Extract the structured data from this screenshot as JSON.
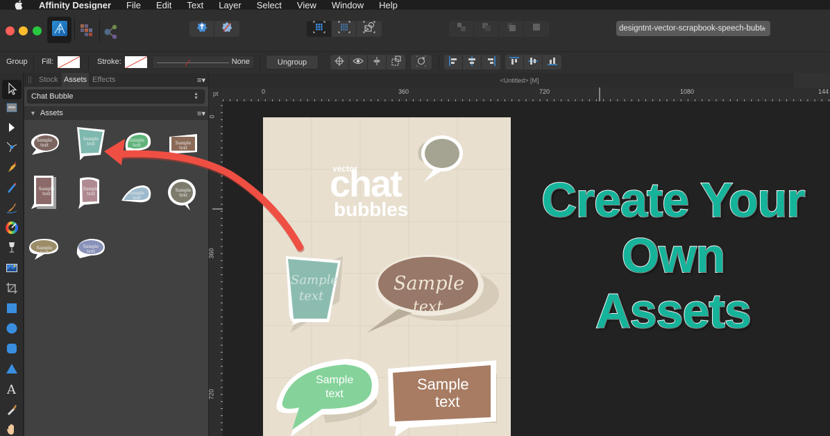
{
  "menubar": {
    "apple_icon": "apple-logo",
    "app_name": "Affinity Designer",
    "items": [
      "File",
      "Edit",
      "Text",
      "Layer",
      "Select",
      "View",
      "Window",
      "Help"
    ]
  },
  "toolbar": {
    "personas": [
      "designer-persona-icon",
      "pixel-persona-icon",
      "export-persona-icon"
    ],
    "isolation_buttons": [
      "place-image-icon",
      "no-preview-icon"
    ],
    "view_modes": [
      "pixel-grid-icon",
      "retina-grid-icon",
      "vector-outline-icon"
    ],
    "arrange_buttons": [
      "move-back-icon",
      "move-backward-icon",
      "move-forward-icon",
      "move-front-icon"
    ],
    "document_tab": "designtnt-vector-scrapbook-speech-bubt",
    "document_tab_star": "★"
  },
  "context": {
    "selection_type": "Group",
    "fill_label": "Fill:",
    "stroke_label": "Stroke:",
    "stroke_width_value": "None",
    "ungroup_label": "Ungroup",
    "transform_icons": [
      "origin-icon",
      "visibility-icon",
      "flip-icon",
      "constraint-icon"
    ],
    "rotate_icon": "rotate-icon",
    "align_h_icons": [
      "align-left-icon",
      "align-center-icon",
      "align-right-icon"
    ],
    "align_v_icons": [
      "align-top-icon",
      "align-middle-icon",
      "align-bottom-icon"
    ]
  },
  "tools": [
    "move-tool",
    "artboard-tool",
    "node-tool",
    "corner-tool",
    "pen-tool",
    "pencil-tool",
    "vector-brush-tool",
    "fill-tool",
    "transparency-tool",
    "place-image-tool",
    "crop-tool",
    "rectangle-tool",
    "ellipse-tool",
    "rounded-rectangle-tool",
    "triangle-tool",
    "text-tool",
    "color-picker-tool",
    "hand-tool"
  ],
  "panel": {
    "tabs": [
      {
        "label": "Stock",
        "active": false
      },
      {
        "label": "Assets",
        "active": true
      },
      {
        "label": "Effects",
        "active": false
      }
    ],
    "category": "Chat Bubble",
    "section_title": "Assets",
    "assets": [
      {
        "name": "brown-oval-bubble",
        "color": "#7d655f",
        "label": "Sample text"
      },
      {
        "name": "teal-square-bubble",
        "color": "#7fb8ae",
        "label": "Sample text"
      },
      {
        "name": "green-blob-bubble",
        "color": "#5fb47a",
        "label": "Sample text"
      },
      {
        "name": "brown-rect-bubble",
        "color": "#8b6a58",
        "label": "Sample text"
      },
      {
        "name": "mauve-tall-bubble",
        "color": "#8c6a69",
        "label": "Sample text"
      },
      {
        "name": "pink-wavy-bubble",
        "color": "#b08a91",
        "label": "Sample text"
      },
      {
        "name": "blue-drop-bubble",
        "color": "#9cbacb",
        "label": "Sample text"
      },
      {
        "name": "olive-round-bubble",
        "color": "#7d7b6c",
        "label": "Sample text"
      },
      {
        "name": "khaki-wide-bubble",
        "color": "#9c8c68",
        "label": "Sample text"
      },
      {
        "name": "periwinkle-bubble",
        "color": "#8891b8",
        "label": "Sample text"
      }
    ]
  },
  "document": {
    "title": "<Untitled> [M]",
    "ruler_unit": "pt",
    "ruler_h_labels": [
      "0",
      "360",
      "720",
      "1080",
      "144"
    ],
    "ruler_v_labels": [
      "0",
      "360",
      "720"
    ]
  },
  "artboard": {
    "title_small": "vector",
    "title_big": "chat",
    "title_sub": "bubbles",
    "bubbles": [
      {
        "name": "teal-bubble",
        "line1": "Sample",
        "line2": "text",
        "color": "#8cbcb0"
      },
      {
        "name": "brown-oval-bubble",
        "line1": "Sample",
        "line2": "text",
        "color": "#987868"
      },
      {
        "name": "green-bubble",
        "line1": "Sample",
        "line2": "text",
        "color": "#85d39a"
      },
      {
        "name": "brown-rect-bubble",
        "line1": "Sample",
        "line2": "text",
        "color": "#a77c63"
      }
    ]
  },
  "headline": {
    "line1": "Create Your",
    "line2": "Own",
    "line3": "Assets",
    "color": "#16b39b"
  },
  "annotation": {
    "arrow_color": "#ef4f43"
  }
}
